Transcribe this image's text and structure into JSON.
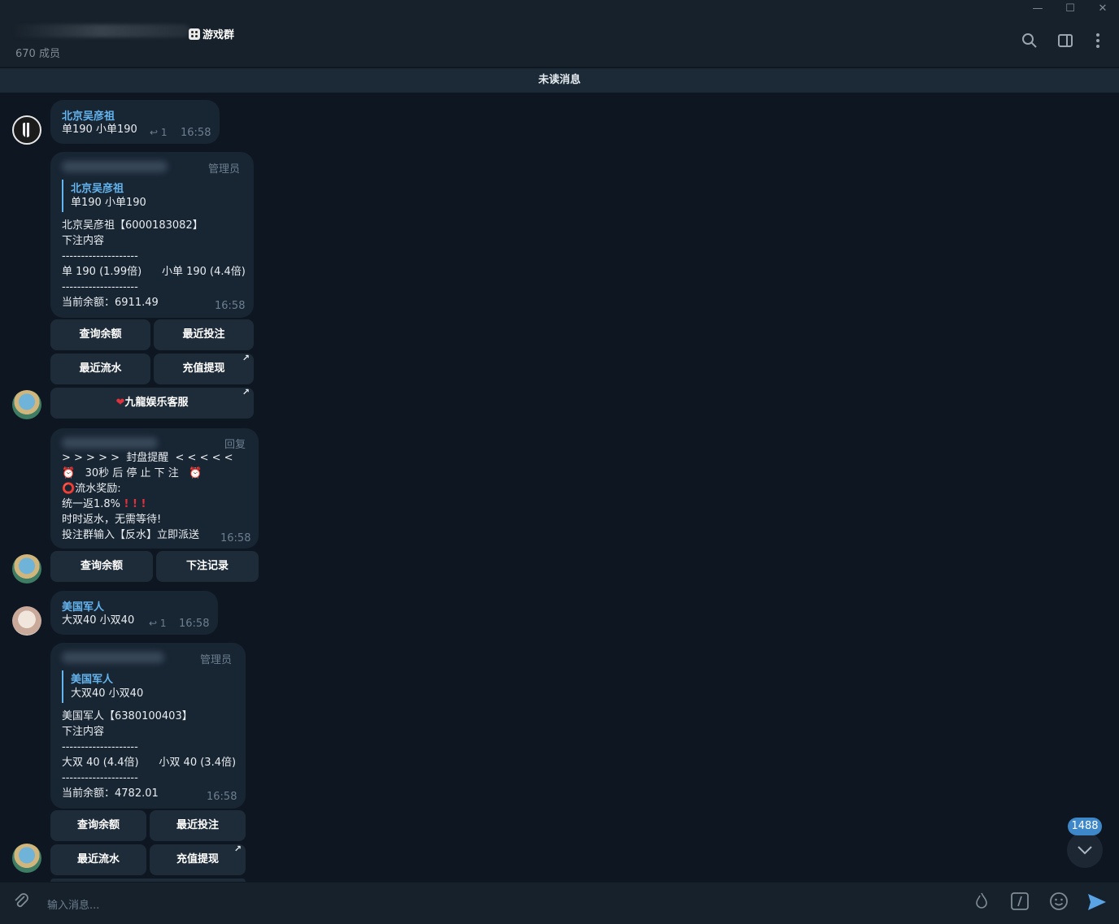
{
  "window": {
    "minimize": "—",
    "maximize": "☐",
    "close": "✕"
  },
  "header": {
    "title": "游戏群",
    "members": "670 成员"
  },
  "unread": "未读消息",
  "messages": {
    "m1": {
      "sender": "北京吴彦祖",
      "text": "单190 小单190",
      "replies": "1",
      "time": "16:58"
    },
    "m2": {
      "badge": "管理员",
      "quote_name": "北京吴彦祖",
      "quote_text": "单190 小单190",
      "lines": [
        "北京吴彦祖【6000183082】",
        "下注内容",
        "--------------------",
        "单 190 (1.99倍)      小单 190 (4.4倍)",
        "--------------------",
        "当前余额：6911.49"
      ],
      "time": "16:58",
      "buttons": [
        "查询余额",
        "最近投注",
        "最近流水",
        "充值提现",
        "九龍娱乐客服"
      ]
    },
    "m3": {
      "badge": "回复",
      "lines": [
        "> > > > >  封盘提醒  < < < < <",
        "   30秒 后 停 止 下 注   ",
        "流水奖励:",
        "统一返1.8%",
        "时时返水，无需等待!",
        "投注群输入【反水】立即派送"
      ],
      "time": "16:58",
      "buttons": [
        "查询余额",
        "下注记录"
      ]
    },
    "m4": {
      "sender": "美国军人",
      "text": "大双40 小双40",
      "replies": "1",
      "time": "16:58"
    },
    "m5": {
      "badge": "管理员",
      "quote_name": "美国军人",
      "quote_text": "大双40 小双40",
      "lines": [
        "美国军人【6380100403】",
        "下注内容",
        "--------------------",
        "大双 40 (4.4倍)      小双 40 (3.4倍)",
        "--------------------",
        "当前余额：4782.01"
      ],
      "time": "16:58",
      "buttons": [
        "查询余额",
        "最近投注",
        "最近流水",
        "充值提现"
      ]
    }
  },
  "scroll": {
    "count": "1488"
  },
  "input": {
    "placeholder": "输入消息..."
  },
  "colors": {
    "accent": "#64b5ef",
    "background": "#0e1621",
    "bubble": "#182533",
    "badge": "#3e88c9"
  }
}
